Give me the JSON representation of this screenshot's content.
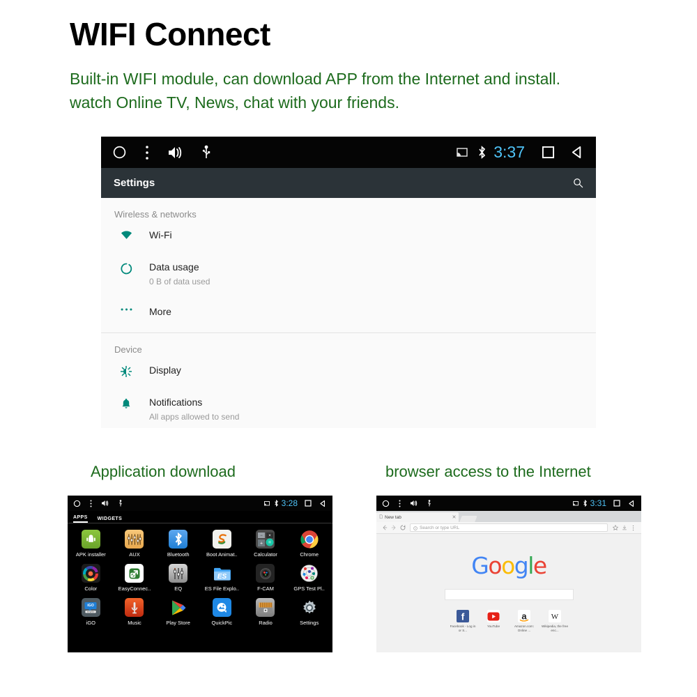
{
  "header": {
    "title": "WIFI Connect",
    "description_line1": "Built-in WIFI module, can download APP from the Internet and install.",
    "description_line2": "watch Online TV, News, chat with your friends."
  },
  "colors": {
    "heading": "#000000",
    "body_green": "#1d6b1d",
    "settings_accent": "#00897b",
    "status_time": "#4fc3f7",
    "actionbar": "#2b3338"
  },
  "settings_screen": {
    "statusbar": {
      "left_icons": [
        "home-circle-icon",
        "overflow-menu-icon",
        "volume-icon",
        "usb-icon"
      ],
      "right_icons": [
        "cast-icon",
        "bluetooth-icon"
      ],
      "time": "3:37",
      "nav_icons": [
        "recents-square-icon",
        "back-triangle-icon"
      ]
    },
    "actionbar": {
      "title": "Settings",
      "search_icon": "search-icon"
    },
    "sections": [
      {
        "header": "Wireless & networks",
        "items": [
          {
            "icon": "wifi-icon",
            "title": "Wi-Fi",
            "subtitle": ""
          },
          {
            "icon": "data-usage-icon",
            "title": "Data usage",
            "subtitle": "0 B of data used"
          },
          {
            "icon": "more-dots-icon",
            "title": "More",
            "subtitle": ""
          }
        ]
      },
      {
        "header": "Device",
        "items": [
          {
            "icon": "display-brightness-icon",
            "title": "Display",
            "subtitle": ""
          },
          {
            "icon": "notifications-bell-icon",
            "title": "Notifications",
            "subtitle": "All apps allowed to send"
          }
        ]
      }
    ]
  },
  "captions": {
    "left": "Application download",
    "right": "browser access to the Internet"
  },
  "app_drawer": {
    "statusbar": {
      "time": "3:28"
    },
    "tabs": [
      {
        "label": "APPS",
        "active": true
      },
      {
        "label": "WIDGETS",
        "active": false
      }
    ],
    "apps": [
      {
        "label": "APK installer",
        "icon": "android-robot-icon"
      },
      {
        "label": "AUX",
        "icon": "aux-mixer-icon"
      },
      {
        "label": "Bluetooth",
        "icon": "bluetooth-icon"
      },
      {
        "label": "Boot Animat..",
        "icon": "boot-animation-icon"
      },
      {
        "label": "Calculator",
        "icon": "calculator-icon"
      },
      {
        "label": "Chrome",
        "icon": "chrome-icon"
      },
      {
        "label": "Color",
        "icon": "color-wheel-icon"
      },
      {
        "label": "EasyConnec..",
        "icon": "easyconnect-icon"
      },
      {
        "label": "EQ",
        "icon": "equalizer-icon"
      },
      {
        "label": "ES File Explo..",
        "icon": "es-file-explorer-icon"
      },
      {
        "label": "F-CAM",
        "icon": "camera-icon"
      },
      {
        "label": "GPS Test Pl..",
        "icon": "gps-test-icon"
      },
      {
        "label": "iGO",
        "icon": "igo-navigation-icon"
      },
      {
        "label": "Music",
        "icon": "music-icon"
      },
      {
        "label": "Play Store",
        "icon": "play-store-icon"
      },
      {
        "label": "QuickPic",
        "icon": "quickpic-icon"
      },
      {
        "label": "Radio",
        "icon": "radio-icon"
      },
      {
        "label": "Settings",
        "icon": "settings-gear-icon"
      }
    ]
  },
  "browser": {
    "statusbar": {
      "time": "3:31"
    },
    "tab": {
      "title": "New tab",
      "close_icon": "close-icon",
      "new_tab_icon": "new-tab-icon"
    },
    "toolbar": {
      "back_icon": "back-arrow-icon",
      "forward_icon": "forward-arrow-icon",
      "reload_icon": "reload-icon",
      "omnibox_placeholder": "Search or type URL",
      "info_icon": "info-icon",
      "bookmark_icon": "star-icon",
      "download_icon": "download-icon",
      "menu_icon": "overflow-menu-icon"
    },
    "newtab": {
      "logo_letters": [
        "G",
        "o",
        "o",
        "g",
        "l",
        "e"
      ],
      "shortcuts": [
        {
          "label": "Facebook - Log in or S...",
          "icon": "facebook-icon"
        },
        {
          "label": "YouTube",
          "icon": "youtube-icon"
        },
        {
          "label": "Amazon.com: Online ...",
          "icon": "amazon-icon"
        },
        {
          "label": "Wikipedia, the free enc...",
          "icon": "wikipedia-icon"
        }
      ]
    }
  }
}
